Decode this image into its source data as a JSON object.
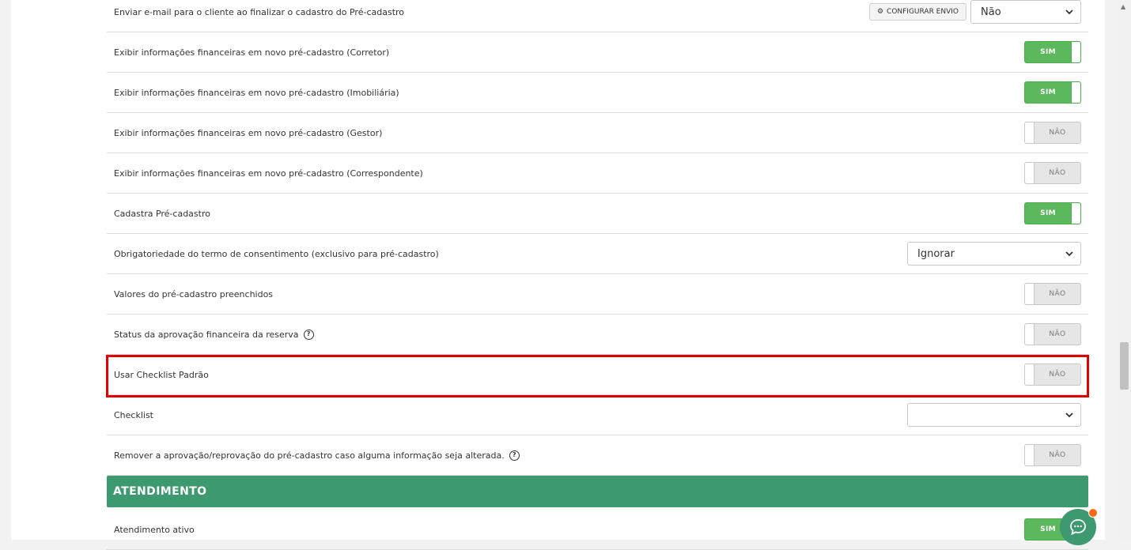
{
  "rows": [
    {
      "label": "Enviar e-mail para o cliente ao finalizar o cadastro do Pré-cadastro",
      "button": "CONFIGURAR ENVIO",
      "select": "Não"
    },
    {
      "label": "Exibir informações financeiras em novo pré-cadastro (Corretor)",
      "toggle": "SIM"
    },
    {
      "label": "Exibir informações financeiras em novo pré-cadastro (Imobiliária)",
      "toggle": "SIM"
    },
    {
      "label": "Exibir informações financeiras em novo pré-cadastro (Gestor)",
      "toggle": "NÃO"
    },
    {
      "label": "Exibir informações financeiras em novo pré-cadastro (Correspondente)",
      "toggle": "NÃO"
    },
    {
      "label": "Cadastra Pré-cadastro",
      "toggle": "SIM"
    },
    {
      "label": "Obrigatoriedade do termo de consentimento (exclusivo para pré-cadastro)",
      "select": "Ignorar"
    },
    {
      "label": "Valores do pré-cadastro preenchidos",
      "toggle": "NÃO"
    },
    {
      "label": "Status da aprovação financeira da reserva",
      "toggle": "NÃO"
    },
    {
      "label": "Usar Checklist Padrão",
      "toggle": "NÃO"
    },
    {
      "label": "Checklist",
      "select": ""
    },
    {
      "label": "Remover a aprovação/reprovação do pré-cadastro caso alguma informação seja alterada.",
      "toggle": "NÃO"
    }
  ],
  "section": {
    "title": "ATENDIMENTO"
  },
  "last_row": {
    "label": "Atendimento ativo",
    "toggle": "SIM"
  },
  "colors": {
    "accent": "#3d9970",
    "on": "#5cb85c",
    "highlight": "#e00000",
    "chat_dot": "#ff6a13"
  },
  "icons": {
    "gear": "gear-icon",
    "help": "question-circle-icon",
    "chevron": "chevron-down-icon",
    "chat": "chat-bubble-icon"
  }
}
